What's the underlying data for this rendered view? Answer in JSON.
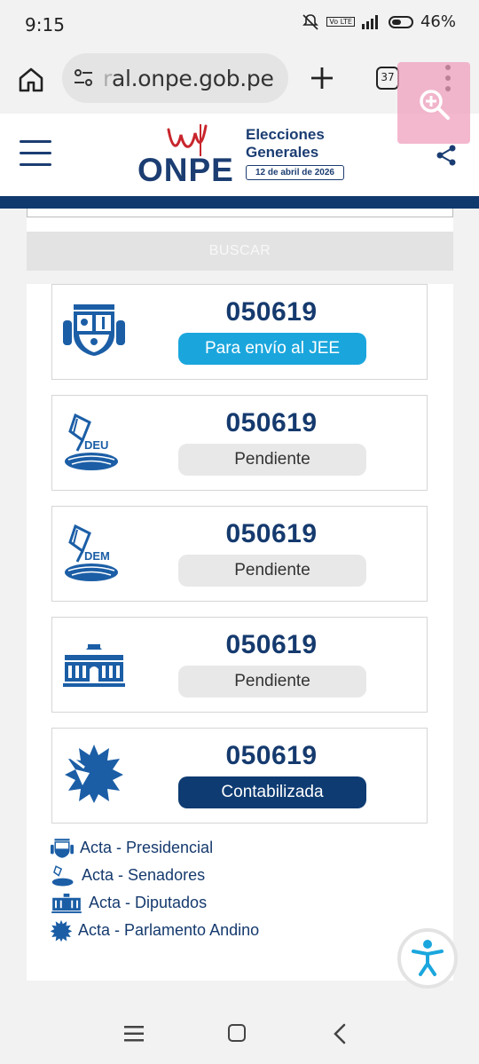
{
  "status_bar": {
    "time": "9:15",
    "battery": "46%",
    "network": "Vo LTE"
  },
  "browser": {
    "url_faded": "r",
    "url_main": "al.onpe.gob.pe",
    "tab_count": "37"
  },
  "header": {
    "logo_text": "ONPE",
    "elecciones_line1": "Elecciones",
    "elecciones_line2": "Generales",
    "date": "12 de abril de 2026"
  },
  "search": {
    "button_label": "BUSCAR"
  },
  "cards": [
    {
      "icon": "escudo-presidencial-icon",
      "number": "050619",
      "status": "Para envío al JEE",
      "status_type": "jee"
    },
    {
      "icon": "deu-ballot-icon",
      "number": "050619",
      "status": "Pendiente",
      "status_type": "pendiente"
    },
    {
      "icon": "dem-ballot-icon",
      "number": "050619",
      "status": "Pendiente",
      "status_type": "pendiente"
    },
    {
      "icon": "congreso-building-icon",
      "number": "050619",
      "status": "Pendiente",
      "status_type": "pendiente"
    },
    {
      "icon": "parlamento-andino-icon",
      "number": "050619",
      "status": "Contabilizada",
      "status_type": "contabilizada"
    }
  ],
  "legend": [
    {
      "icon": "escudo-presidencial-icon",
      "label": "Acta - Presidencial"
    },
    {
      "icon": "senadores-icon",
      "label": "Acta - Senadores"
    },
    {
      "icon": "diputados-icon",
      "label": "Acta - Diputados"
    },
    {
      "icon": "parlamento-andino-icon",
      "label": "Acta - Parlamento Andino"
    }
  ],
  "colors": {
    "brand_navy": "#153a6e",
    "jee_blue": "#1aa6dd",
    "pending_gray": "#e8e8e8",
    "contabilizada": "#0e3b72"
  }
}
